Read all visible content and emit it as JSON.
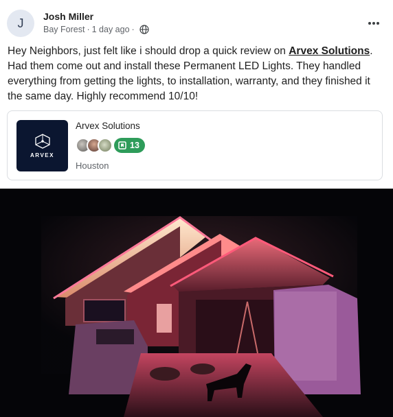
{
  "post": {
    "avatar_initial": "J",
    "author": "Josh Miller",
    "neighborhood": "Bay Forest",
    "separator": "·",
    "time": "1 day ago",
    "audience_icon": "globe-icon",
    "more_icon": "ellipsis-icon",
    "body_before_link": "Hey Neighbors, just felt like i should drop a quick review on ",
    "body_link": "Arvex Solutions",
    "body_after_link": ". Had them come out and install these Permanent LED Lights. They handled everything from getting the lights, to installation, warranty, and they finished it the same day. Highly recommend 10/10!"
  },
  "business": {
    "logo_text": "ARVEX",
    "name": "Arvex Solutions",
    "recommendation_count": "13",
    "location": "Houston",
    "badge_color": "#2e9c5a",
    "logo_bg": "#0b1630"
  },
  "photo": {
    "subject": "house-with-permanent-led-lights-at-night"
  }
}
